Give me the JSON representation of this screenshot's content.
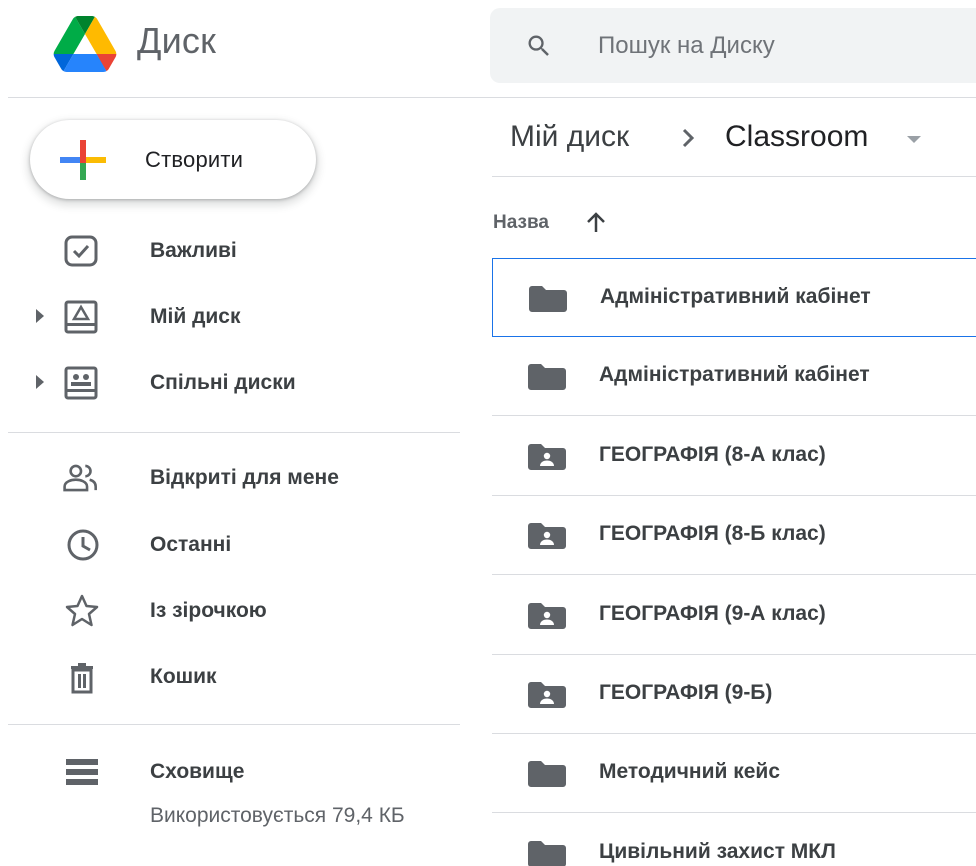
{
  "header": {
    "app_name": "Диск",
    "search_placeholder": "Пошук на Диску"
  },
  "sidebar": {
    "create_label": "Створити",
    "items": [
      {
        "label": "Важливі"
      },
      {
        "label": "Мій диск"
      },
      {
        "label": "Спільні диски"
      },
      {
        "label": "Відкриті для мене"
      },
      {
        "label": "Останні"
      },
      {
        "label": "Із зірочкою"
      },
      {
        "label": "Кошик"
      },
      {
        "label": "Сховище"
      }
    ],
    "storage_used": "Використовується 79,4 КБ"
  },
  "breadcrumb": {
    "root": "Мій диск",
    "separator_icon": "chevron-right-icon",
    "current": "Classroom",
    "dropdown_icon": "caret-down-icon"
  },
  "list": {
    "column_name": "Назва",
    "sort_icon": "arrow-up-icon",
    "files": [
      {
        "name": "Адміністративний кабінет",
        "icon": "folder-icon",
        "selected": true
      },
      {
        "name": "Адміністративний кабінет",
        "icon": "folder-icon",
        "selected": false
      },
      {
        "name": "ГЕОГРАФІЯ (8-А клас)",
        "icon": "shared-folder-icon",
        "selected": false
      },
      {
        "name": "ГЕОГРАФІЯ (8-Б клас)",
        "icon": "shared-folder-icon",
        "selected": false
      },
      {
        "name": "ГЕОГРАФІЯ (9-А клас)",
        "icon": "shared-folder-icon",
        "selected": false
      },
      {
        "name": "ГЕОГРАФІЯ (9-Б)",
        "icon": "shared-folder-icon",
        "selected": false
      },
      {
        "name": "Методичний кейс",
        "icon": "folder-icon",
        "selected": false
      },
      {
        "name": "Цивільний захист МКЛ",
        "icon": "folder-icon",
        "selected": false
      }
    ]
  },
  "colors": {
    "accent_blue": "#1a73e8",
    "icon_gray": "#5f6368",
    "folder_gray": "#5f6368",
    "search_bg": "#f1f3f4",
    "divider": "#dadce0"
  }
}
